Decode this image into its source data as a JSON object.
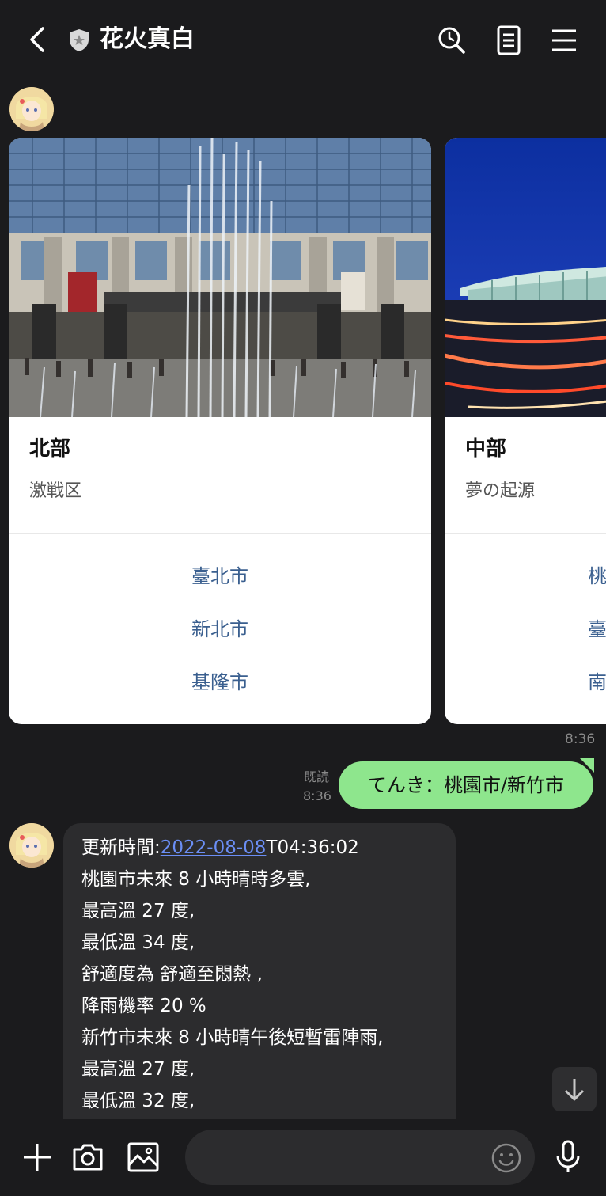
{
  "header": {
    "title": "花火真白"
  },
  "cards": [
    {
      "title": "北部",
      "subtitle": "激戦区",
      "links": [
        "臺北市",
        "新北市",
        "基隆市"
      ]
    },
    {
      "title": "中部",
      "subtitle": "夢の起源",
      "links": [
        "桃",
        "臺",
        "南"
      ]
    }
  ],
  "card_time": "8:36",
  "sent": {
    "text": "てんき：桃園市/新竹市",
    "read_label": "既読",
    "time": "8:36"
  },
  "received": {
    "update_prefix": "更新時間:",
    "update_date": "2022-08-08",
    "update_time": "T04:36:02",
    "lines": [
      "桃園市未來 8 小時晴時多雲,",
      "最高溫 27 度,",
      "最低溫 34 度,",
      "舒適度為 舒適至悶熱 ,",
      "降雨機率 20 %",
      "新竹市未來 8 小時晴午後短暫雷陣雨,",
      "最高溫 27 度,",
      "最低溫 32 度,"
    ]
  },
  "input": {
    "placeholder": ""
  },
  "colors": {
    "background": "#1b1b1d",
    "sent_bubble": "#8ee68d",
    "received_bubble": "#2c2c2e",
    "link": "#3a5f8f",
    "date_link": "#6b8ef5"
  },
  "icons": [
    "back-arrow-icon",
    "shield-icon",
    "search-clock-icon",
    "notes-icon",
    "menu-icon",
    "arrow-down-icon",
    "plus-icon",
    "camera-icon",
    "image-icon",
    "emoji-icon",
    "mic-icon"
  ]
}
